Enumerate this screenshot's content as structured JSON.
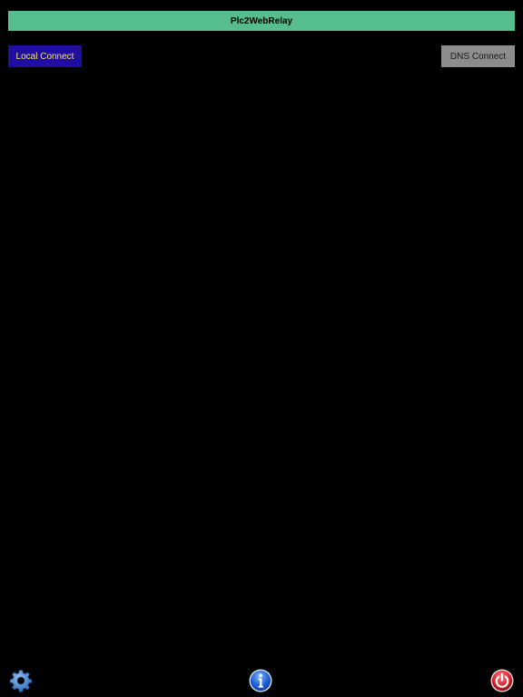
{
  "header": {
    "title": "Plc2WebRelay"
  },
  "connect": {
    "local_label": "Local Connect",
    "dns_label": "DNS Connect"
  },
  "toolbar": {
    "settings_icon": "gear-icon",
    "info_icon": "info-icon",
    "power_icon": "power-icon"
  },
  "colors": {
    "background": "#000000",
    "title_bar": "#56be8c",
    "local_button": "#1f0ea0",
    "local_button_text": "#f2e66a",
    "dns_button": "#8c8c8c",
    "info_blue": "#1e5fd6",
    "power_red": "#d8202a",
    "gear_blue": "#3a78c8"
  }
}
